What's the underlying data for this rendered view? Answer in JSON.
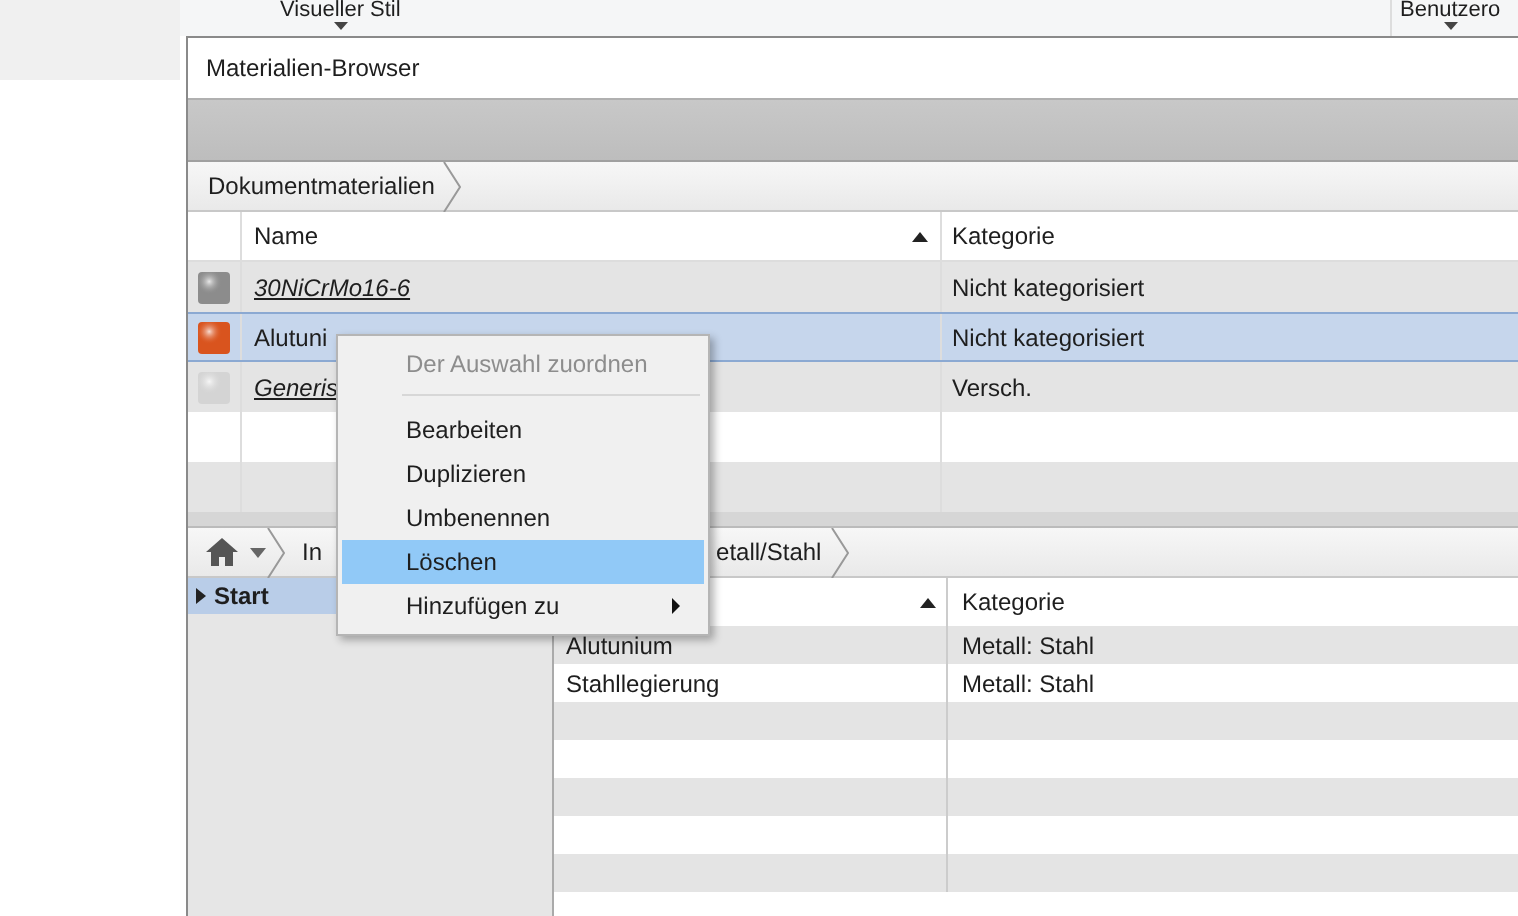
{
  "ribbon": {
    "items": [
      {
        "label": "Visueller Stil"
      },
      {
        "label": "Benutzero"
      }
    ]
  },
  "window": {
    "title": "Materialien-Browser"
  },
  "document_breadcrumb": [
    "Dokumentmaterialien"
  ],
  "document_table": {
    "columns": [
      "Name",
      "Kategorie"
    ],
    "rows": [
      {
        "name": "30NiCrMo16-6",
        "category": "Nicht kategorisiert",
        "color": "#8c8c8c",
        "linked": true,
        "selected": false
      },
      {
        "name": "Alutuni",
        "category": "Nicht kategorisiert",
        "color": "#d9541e",
        "linked": false,
        "selected": true
      },
      {
        "name": "Generis",
        "category": "Versch.",
        "color": "#d4d4d4",
        "linked": true,
        "selected": false
      }
    ]
  },
  "library_breadcrumb": [
    "In",
    "etall/Stahl"
  ],
  "tree": [
    {
      "label": "Start",
      "selected": true
    }
  ],
  "library_table": {
    "columns": [
      "Kategorie"
    ],
    "rows": [
      {
        "name": "Alutunium",
        "category": "Metall: Stahl"
      },
      {
        "name": "Stahllegierung",
        "category": "Metall: Stahl"
      }
    ]
  },
  "context_menu": {
    "items": [
      {
        "kind": "item",
        "label": "Der Auswahl zuordnen",
        "disabled": true,
        "selected": false,
        "submenu": false
      },
      {
        "kind": "separator"
      },
      {
        "kind": "item",
        "label": "Bearbeiten",
        "disabled": false,
        "selected": false,
        "submenu": false
      },
      {
        "kind": "item",
        "label": "Duplizieren",
        "disabled": false,
        "selected": false,
        "submenu": false
      },
      {
        "kind": "item",
        "label": "Umbenennen",
        "disabled": false,
        "selected": false,
        "submenu": false
      },
      {
        "kind": "item",
        "label": "Löschen",
        "disabled": false,
        "selected": true,
        "submenu": false
      },
      {
        "kind": "item",
        "label": "Hinzufügen zu",
        "disabled": false,
        "selected": false,
        "submenu": true
      }
    ]
  }
}
